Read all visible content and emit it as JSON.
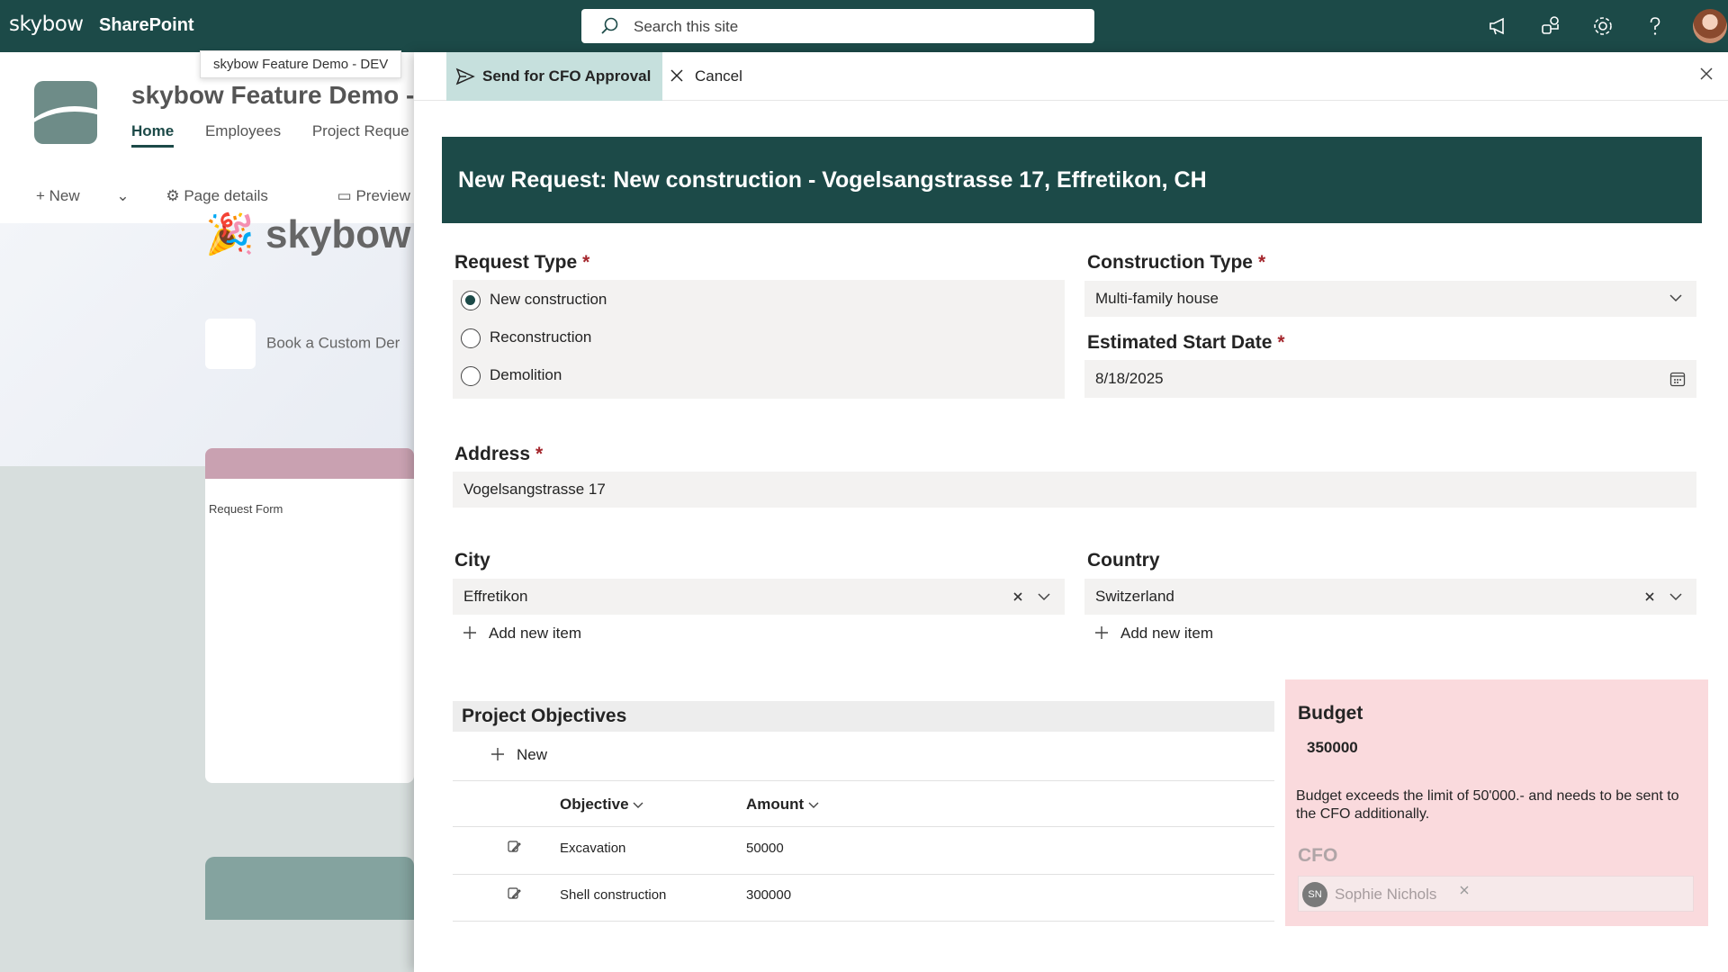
{
  "suitebar": {
    "logo": "skybow",
    "app_name": "SharePoint",
    "search_placeholder": "Search this site",
    "icons": [
      "megaphone-icon",
      "share-icon",
      "gear-icon",
      "help-icon",
      "avatar"
    ]
  },
  "site": {
    "tooltip": "skybow Feature Demo - DEV",
    "title": "skybow Feature Demo -",
    "nav": [
      "Home",
      "Employees",
      "Project Reque"
    ],
    "commands": {
      "new": "New",
      "page_details": "Page details",
      "preview": "Preview"
    },
    "hero_title": "skybow D",
    "book_button": "Book a Custom Der",
    "card_label": "Request Form"
  },
  "panel": {
    "toolbar": {
      "send": "Send for CFO Approval",
      "cancel": "Cancel"
    },
    "header": "New Request: New construction - Vogelsangstrasse 17, Effretikon, CH",
    "request_type": {
      "label": "Request Type",
      "required": "*",
      "options": [
        "New construction",
        "Reconstruction",
        "Demolition"
      ],
      "selected": "New construction"
    },
    "construction_type": {
      "label": "Construction Type",
      "required": "*",
      "value": "Multi-family house"
    },
    "start_date": {
      "label": "Estimated Start Date",
      "required": "*",
      "value": "8/18/2025"
    },
    "address": {
      "label": "Address",
      "required": "*",
      "value": "Vogelsangstrasse 17"
    },
    "city": {
      "label": "City",
      "value": "Effretikon",
      "add_new": "Add new item"
    },
    "country": {
      "label": "Country",
      "value": "Switzerland",
      "add_new": "Add new item"
    },
    "objectives": {
      "title": "Project Objectives",
      "new_label": "New",
      "columns": [
        "Objective",
        "Amount"
      ],
      "rows": [
        {
          "objective": "Excavation",
          "amount": "50000"
        },
        {
          "objective": "Shell construction",
          "amount": "300000"
        }
      ]
    },
    "budget": {
      "label": "Budget",
      "value": "350000",
      "message": "Budget exceeds the limit of 50'000.- and needs to be sent to the CFO additionally.",
      "cfo_label": "CFO",
      "cfo_initials": "SN",
      "cfo_name": "Sophie Nichols"
    }
  },
  "colors": {
    "brand": "#1c4a48",
    "accent_light": "#c6e0dd",
    "warning_bg": "#fadadd",
    "required": "#a4262c"
  }
}
